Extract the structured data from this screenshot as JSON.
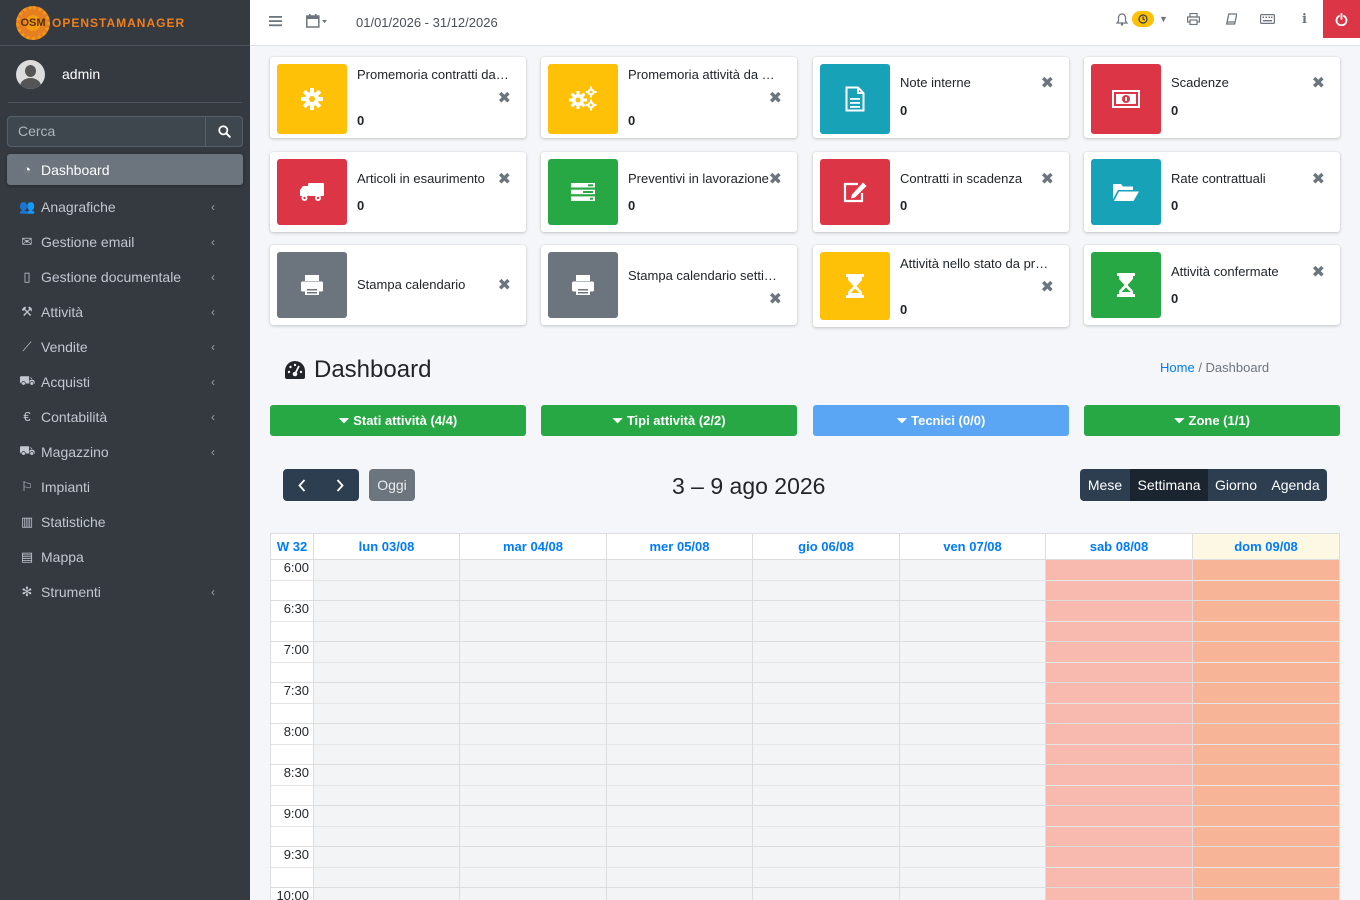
{
  "app": {
    "brand": "OpenSTAManager",
    "logo_initials": "OSM"
  },
  "user": {
    "name": "admin"
  },
  "sidebar": {
    "search_placeholder": "Cerca",
    "items": [
      {
        "label": "Dashboard",
        "icon": "dashboard-icon",
        "active": true
      },
      {
        "label": "Anagrafiche",
        "icon": "users-icon"
      },
      {
        "label": "Gestione email",
        "icon": "envelope-icon"
      },
      {
        "label": "Gestione documentale",
        "icon": "file-icon"
      },
      {
        "label": "Attività",
        "icon": "wrench-icon"
      },
      {
        "label": "Vendite",
        "icon": "chart-line-icon"
      },
      {
        "label": "Acquisti",
        "icon": "cart-icon"
      },
      {
        "label": "Contabilità",
        "icon": "euro-icon"
      },
      {
        "label": "Magazzino",
        "icon": "truck-icon"
      },
      {
        "label": "Impianti",
        "icon": "sitemap-icon"
      },
      {
        "label": "Statistiche",
        "icon": "bar-chart-icon"
      },
      {
        "label": "Mappa",
        "icon": "map-icon"
      },
      {
        "label": "Strumenti",
        "icon": "cog-icon"
      }
    ]
  },
  "topbar": {
    "period": "01/01/2026 - 31/12/2026"
  },
  "widgets": [
    {
      "title": "Promemoria contratti da pianificare",
      "count": "0",
      "color": "#ffc107",
      "icon": "cog-icon"
    },
    {
      "title": "Promemoria attività da pianificare",
      "count": "0",
      "color": "#ffc107",
      "icon": "cogs-icon"
    },
    {
      "title": "Note interne",
      "count": "0",
      "color": "#17a2b8",
      "icon": "file-text-icon"
    },
    {
      "title": "Scadenze",
      "count": "0",
      "color": "#dc3545",
      "icon": "money-icon"
    },
    {
      "title": "Articoli in esaurimento",
      "count": "0",
      "color": "#dc3545",
      "icon": "truck-icon"
    },
    {
      "title": "Preventivi in lavorazione",
      "count": "0",
      "color": "#28a745",
      "icon": "tasks-icon"
    },
    {
      "title": "Contratti in scadenza",
      "count": "0",
      "color": "#dc3545",
      "icon": "edit-icon"
    },
    {
      "title": "Rate contrattuali",
      "count": "0",
      "color": "#17a2b8",
      "icon": "folder-open-icon"
    },
    {
      "title": "Stampa calendario",
      "count": "",
      "color": "#6c757d",
      "icon": "print-icon"
    },
    {
      "title": "Stampa calendario settimanale",
      "count": "",
      "color": "#6c757d",
      "icon": "print-icon"
    },
    {
      "title": "Attività nello stato da programmare",
      "count": "0",
      "color": "#ffc107",
      "icon": "hourglass-icon"
    },
    {
      "title": "Attività confermate",
      "count": "0",
      "color": "#28a745",
      "icon": "hourglass-icon"
    }
  ],
  "page": {
    "title": "Dashboard",
    "breadcrumb_home": "Home",
    "breadcrumb_current": "Dashboard"
  },
  "filters": [
    {
      "label": "Stati attività (4/4)",
      "color": "#28a745"
    },
    {
      "label": "Tipi attività (2/2)",
      "color": "#28a745"
    },
    {
      "label": "Tecnici (0/0)",
      "color": "#5aa6f5"
    },
    {
      "label": "Zone (1/1)",
      "color": "#28a745"
    }
  ],
  "calendar": {
    "today_label": "Oggi",
    "title": "3 – 9 ago 2026",
    "views": [
      "Mese",
      "Settimana",
      "Giorno",
      "Agenda"
    ],
    "active_view": "Settimana",
    "week_label": "W 32",
    "days": [
      "lun 03/08",
      "mar 04/08",
      "mer 05/08",
      "gio 06/08",
      "ven 07/08",
      "sab 08/08",
      "dom 09/08"
    ],
    "times": [
      "6:00",
      "6:30",
      "7:00",
      "7:30",
      "8:00",
      "8:30",
      "9:00",
      "9:30",
      "10:00"
    ]
  }
}
